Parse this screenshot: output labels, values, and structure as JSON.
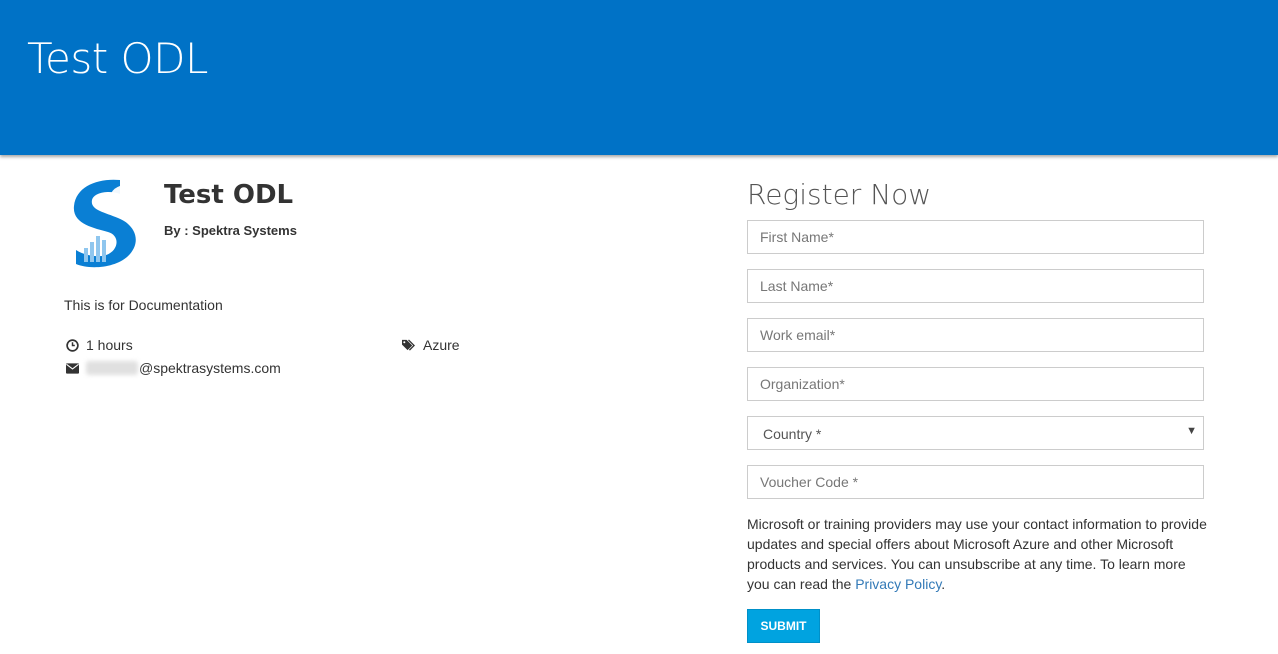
{
  "header": {
    "title": "Test ODL"
  },
  "course": {
    "title": "Test ODL",
    "by": "By : Spektra Systems",
    "description": "This is for Documentation",
    "duration": "1 hours",
    "tag": "Azure",
    "email_domain": "@spektrasystems.com"
  },
  "icons": {
    "logo": "spektra-s-logo",
    "duration": "clock-icon",
    "tag": "tags-icon",
    "email": "envelope-icon"
  },
  "form": {
    "title": "Register Now",
    "first_name_placeholder": "First Name*",
    "last_name_placeholder": "Last Name*",
    "email_placeholder": "Work email*",
    "organization_placeholder": "Organization*",
    "country_selected": "Country *",
    "voucher_placeholder": "Voucher Code *",
    "disclaimer_text": "Microsoft or training providers may use your contact information to provide updates and special offers about Microsoft Azure and other Microsoft products and services. You can unsubscribe at any time. To learn more you can read the ",
    "privacy_link": "Privacy Policy",
    "disclaimer_end": ".",
    "submit_label": "SUBMIT"
  },
  "colors": {
    "header_bg": "#0072c6",
    "submit_bg": "#00a3e0",
    "link": "#337ab7"
  }
}
